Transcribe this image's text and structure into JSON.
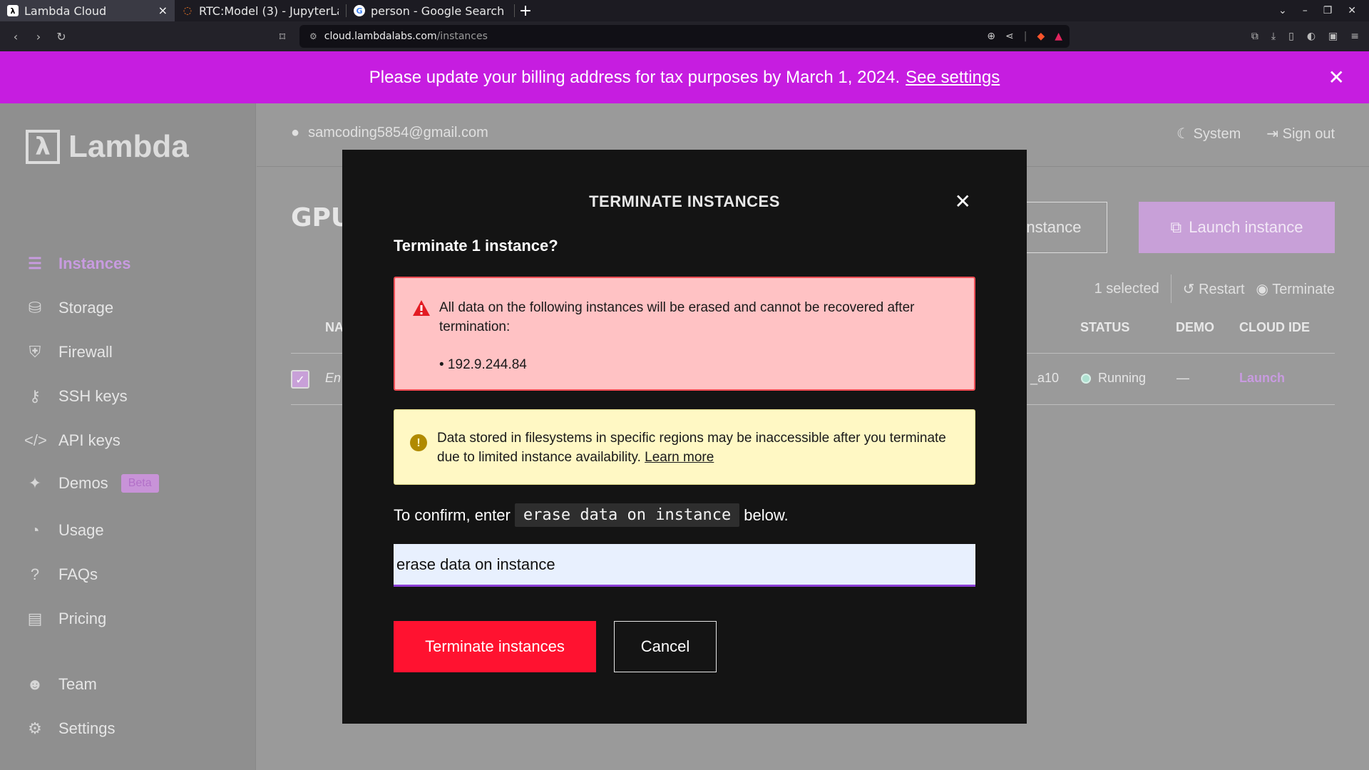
{
  "browser": {
    "tabs": [
      {
        "title": "Lambda Cloud",
        "favicon": "lambda-logo-icon",
        "active": true
      },
      {
        "title": "RTC:Model (3) - JupyterLa",
        "favicon": "jupyter-icon",
        "active": false
      },
      {
        "title": "person - Google Search",
        "favicon": "google-icon",
        "active": false
      }
    ],
    "url_host": "cloud.lambdalabs.com",
    "url_path": "/instances"
  },
  "banner": {
    "text": "Please update your billing address for tax purposes by March 1, 2024.",
    "link": "See settings",
    "color": "#c61de0"
  },
  "sidebar": {
    "logo": "Lambda",
    "items": [
      {
        "label": "Instances",
        "icon": "instances-icon",
        "active": true
      },
      {
        "label": "Storage",
        "icon": "database-icon"
      },
      {
        "label": "Firewall",
        "icon": "shield-icon"
      },
      {
        "label": "SSH keys",
        "icon": "key-icon"
      },
      {
        "label": "API keys",
        "icon": "code-icon"
      },
      {
        "label": "Demos",
        "icon": "sparkle-icon",
        "badge": "Beta"
      },
      {
        "label": "Usage",
        "icon": "gauge-icon"
      },
      {
        "label": "FAQs",
        "icon": "question-icon"
      },
      {
        "label": "Pricing",
        "icon": "money-icon"
      },
      {
        "label": "Team",
        "icon": "team-icon"
      },
      {
        "label": "Settings",
        "icon": "user-gear-icon"
      }
    ]
  },
  "header": {
    "user_email": "samcoding5854@gmail.com",
    "theme_label": "System",
    "sign_out_label": "Sign out"
  },
  "page": {
    "title_partial": "GPU",
    "outline_button_partial": "instance",
    "launch_button": "Launch instance",
    "selected_count": "1 selected",
    "restart_label": "Restart",
    "terminate_label": "Terminate",
    "columns": {
      "name_partial": "NA",
      "status": "STATUS",
      "demo": "DEMO",
      "cloud_ide": "CLOUD IDE"
    },
    "row": {
      "name_partial": "En",
      "type_partial": "_a10",
      "status": "Running",
      "demo": "—",
      "cloud_ide": "Launch"
    }
  },
  "modal": {
    "title": "TERMINATE INSTANCES",
    "question": "Terminate 1 instance?",
    "danger_text": "All data on the following instances will be erased and cannot be recovered after termination:",
    "instance_ip": "• 192.9.244.84",
    "warning_text": "Data stored in filesystems in specific regions may be inaccessible after you terminate due to limited instance availability.",
    "learn_more": "Learn more",
    "confirm_prefix": "To confirm, enter",
    "confirm_phrase": "erase data on instance",
    "confirm_suffix": "below.",
    "input_value": "erase data on instance",
    "terminate_button": "Terminate instances",
    "cancel_button": "Cancel",
    "danger_color": "#ff1230"
  }
}
